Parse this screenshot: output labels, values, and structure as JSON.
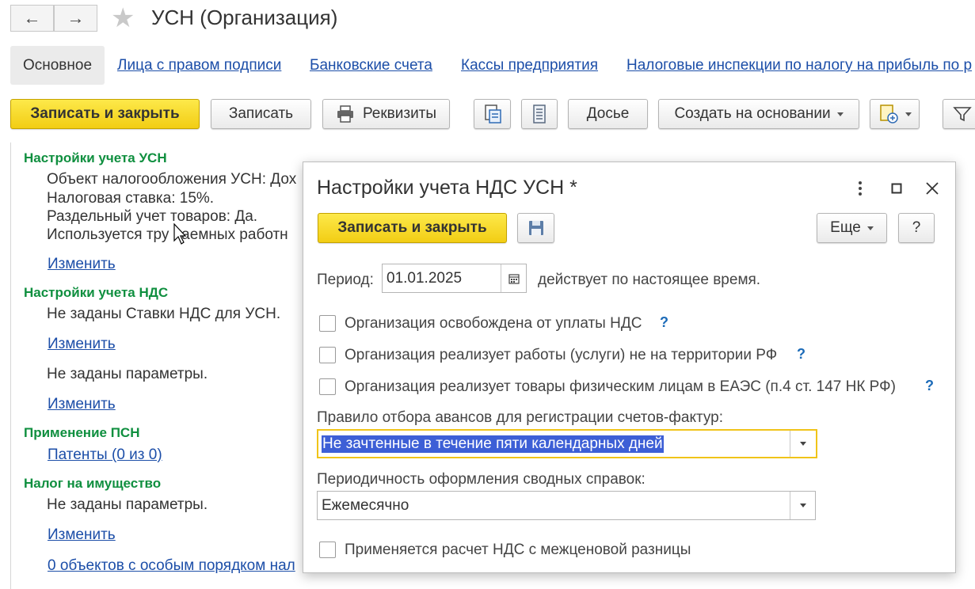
{
  "window": {
    "title": "УСН (Организация)",
    "back_icon": "←",
    "forward_icon": "→",
    "favorite_icon": "★"
  },
  "tabs": {
    "active": "Основное",
    "links": [
      "Лица с правом подписи",
      "Банковские счета",
      "Кассы предприятия",
      "Налоговые инспекции по налогу на прибыль по р"
    ]
  },
  "toolbar": {
    "save_close": "Записать и закрыть",
    "save": "Записать",
    "requisites": "Реквизиты",
    "dossier": "Досье",
    "create_based": "Создать на основании"
  },
  "content": {
    "usn_header": "Настройки учета УСН",
    "usn_lines": [
      "Объект налогообложения УСН: Дох",
      "Налоговая ставка: 15%.",
      "Раздельный учет товаров: Да.",
      "Используется тру    наемных работн"
    ],
    "change1": "Изменить",
    "vat_header": "Настройки учета НДС",
    "vat_line": "Не заданы Ставки НДС для УСН.",
    "change2": "Изменить",
    "params_line": "Не заданы параметры.",
    "change3": "Изменить",
    "psn_header": "Применение ПСН",
    "patents": "Патенты (0 из 0)",
    "property_header": "Налог на имущество",
    "property_line": "Не заданы параметры.",
    "change4": "Изменить",
    "objects_link": "0 объектов с особым порядком нал"
  },
  "dialog": {
    "title": "Настройки учета НДС УСН *",
    "save_close": "Записать и закрыть",
    "more": "Еще",
    "help": "?",
    "period_label": "Период:",
    "period_value": "01.01.2025",
    "period_suffix": "действует по настоящее время.",
    "checkboxes": [
      {
        "label": "Организация освобождена от уплаты НДС",
        "checked": false,
        "help": "?"
      },
      {
        "label": "Организация реализует работы (услуги) не на территории РФ",
        "checked": false,
        "help": "?"
      },
      {
        "label": "Организация реализует товары физическим лицам в ЕАЭС (п.4 ст. 147 НК РФ)",
        "checked": false,
        "help": "?"
      }
    ],
    "advance_rule_label": "Правило отбора авансов для регистрации счетов-фактур:",
    "advance_rule_value": "Не зачтенные в течение пяти календарных дней",
    "periodicity_label": "Периодичность оформления сводных справок:",
    "periodicity_value": "Ежемесячно",
    "margin_vat_label": "Применяется расчет НДС с межценовой разницы",
    "margin_vat_checked": false
  },
  "colors": {
    "accent_yellow": "#f5d21e",
    "link_blue": "#1c4ea8",
    "section_green": "#0f8f3f",
    "selection": "#3d5fd6"
  }
}
